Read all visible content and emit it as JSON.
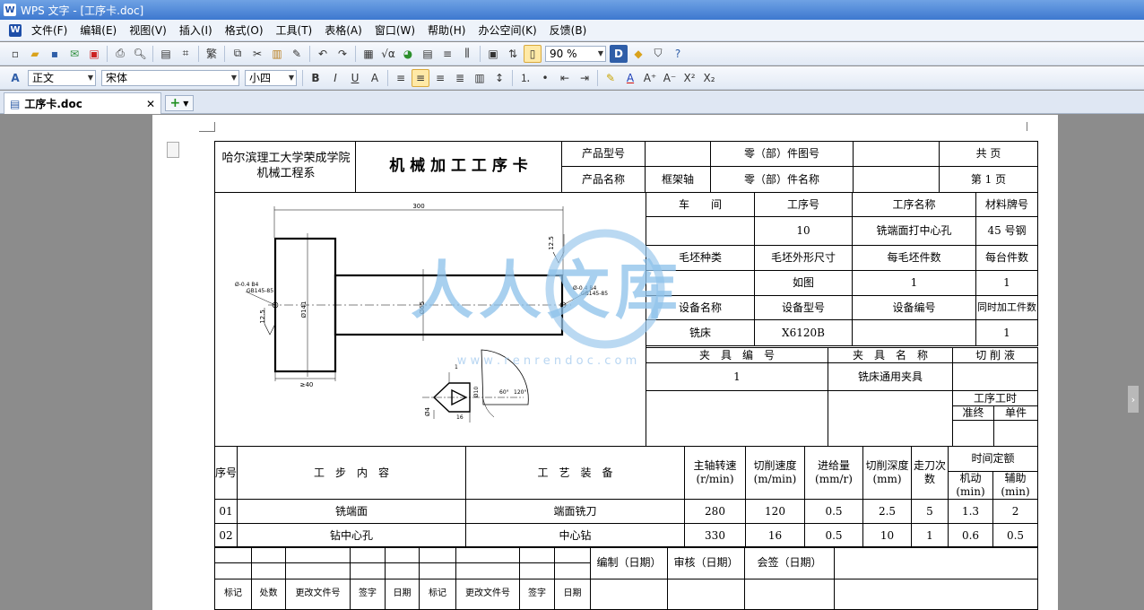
{
  "window": {
    "title": "WPS 文字 - [工序卡.doc]"
  },
  "menu": [
    "文件(F)",
    "编辑(E)",
    "视图(V)",
    "插入(I)",
    "格式(O)",
    "工具(T)",
    "表格(A)",
    "窗口(W)",
    "帮助(H)",
    "办公空间(K)",
    "反馈(B)"
  ],
  "toolbar": {
    "zoom": "90 %",
    "style": "正文",
    "font": "宋体",
    "size": "小四"
  },
  "tab": {
    "name": "工序卡.doc"
  },
  "header": {
    "school": "哈尔滨理工大学荣成学院",
    "dept": "机械工程系",
    "card_title": "机 械 加 工 工 序 卡",
    "product_model_label": "产品型号",
    "product_name_label": "产品名称",
    "product_name": "框架轴",
    "part_no_label": "零（部）件图号",
    "part_name_label": "零（部）件名称",
    "total_pages": "共  页",
    "page_no": "第 1 页"
  },
  "info": {
    "workshop_label": "车　　间",
    "op_no_label": "工序号",
    "op_name_label": "工序名称",
    "material_label": "材料牌号",
    "op_no": "10",
    "op_name": "铣端面打中心孔",
    "material": "45 号钢",
    "blank_type_label": "毛坯种类",
    "blank_size_label": "毛坯外形尺寸",
    "per_blank_label": "每毛坯件数",
    "per_unit_label": "每台件数",
    "blank_size": "如图",
    "per_blank": "1",
    "per_unit": "1",
    "equip_name_label": "设备名称",
    "equip_model_label": "设备型号",
    "equip_no_label": "设备编号",
    "simul_label": "同时加工件数",
    "equip_name": "铣床",
    "equip_model": "X6120B",
    "simul": "1",
    "fixture_no_label": "夹　具　编　号",
    "fixture_name_label": "夹　具　名　称",
    "coolant_label": "切 削 液",
    "fixture_no": "1",
    "fixture_name": "铣床通用夹具",
    "op_time_label": "工序工时",
    "prep_label": "准终",
    "unit_label": "单件"
  },
  "steps": {
    "headers": {
      "no": "序号",
      "content": "工　步　内　容",
      "equip": "工　艺　装　备",
      "speed": "主轴转速(r/min)",
      "cut_speed": "切削速度(m/min)",
      "feed": "进给量(mm/r)",
      "depth": "切削深度(mm)",
      "passes": "走刀次数",
      "time_quota": "时间定额",
      "machine": "机动(min)",
      "aux": "辅助(min)"
    },
    "rows": [
      {
        "no": "01",
        "content": "铣端面",
        "equip": "端面铣刀",
        "speed": "280",
        "cut_speed": "120",
        "feed": "0.5",
        "depth": "2.5",
        "passes": "5",
        "machine": "1.3",
        "aux": "2"
      },
      {
        "no": "02",
        "content": "钻中心孔",
        "equip": "中心钻",
        "speed": "330",
        "cut_speed": "16",
        "feed": "0.5",
        "depth": "10",
        "passes": "1",
        "machine": "0.6",
        "aux": "0.5"
      }
    ]
  },
  "footer": {
    "compile": "编制（日期）",
    "review": "审核（日期）",
    "sign": "会签（日期）",
    "labels": [
      "标记",
      "处数",
      "更改文件号",
      "签字",
      "日期",
      "标记",
      "更改文件号",
      "签字",
      "日期"
    ]
  },
  "drawing": {
    "len": "300",
    "dia_big": "Ø141",
    "dia_small": "Ø65",
    "len_small": "≥40",
    "rough": "12.5",
    "center": "Ø-0.4 B4",
    "std": "GB145-85",
    "d4": "Ø4",
    "d10": "Ø10",
    "angle1": "60°",
    "angle2": "120°",
    "dim1": "1",
    "dim16": "16"
  },
  "watermark": {
    "text": "人人文库",
    "url": "w w w . r e n r e n d o c . c o m"
  }
}
